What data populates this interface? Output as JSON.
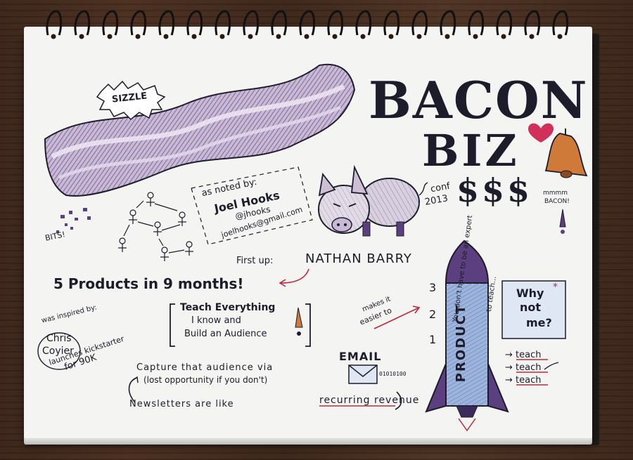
{
  "sketchnote": {
    "sizzle": "SIZZLE",
    "title_line1": "BACON",
    "title_line2": "BIZ",
    "dollars": "$$$",
    "conf": "conf",
    "year": "2013",
    "mmm": "mmmm",
    "mmm_bacon": "BACON!",
    "bits": "BITS!",
    "noted_by": "as noted by:",
    "author": "Joel Hooks",
    "handle": "@jhooks",
    "email": "joelhooks@gmail.com",
    "first_up": "First up:",
    "speaker": "NATHAN BARRY",
    "products": "5 Products in 9 months!",
    "teach_box": [
      "Teach Everything",
      "I know and",
      "Build an Audience"
    ],
    "inspired_by": "was inspired by:",
    "chris_1": "Chris",
    "chris_2": "Coyier",
    "launches": "launches kickstarter",
    "for_90k": "for 90K",
    "capture": "Capture that audience via",
    "email_word": "EMAIL",
    "binary": "01010100",
    "lost_opportunity": "(lost opportunity if you don't)",
    "newsletters": "Newsletters are like",
    "recurring_revenue": "recurring revenue",
    "makes_it_1": "makes it",
    "makes_it_2": "easier to",
    "countdown": [
      "3",
      "2",
      "1"
    ],
    "rocket_label": "PRODUCT",
    "why_not_me": [
      "Why",
      "not",
      "me?"
    ],
    "teach_list": [
      "teach",
      "teach",
      "teach"
    ],
    "expert_1": "You don't have to be an expert",
    "expert_2": "to teach..."
  },
  "colors": {
    "ink": "#1c1c2a",
    "purple": "#5b3f7e",
    "bacon_light": "#c9b8d6",
    "rocket_blue": "#9db4dc",
    "red_ink": "#c0283a",
    "bell_orange": "#d07a3a",
    "heart_pink": "#d0305a"
  }
}
